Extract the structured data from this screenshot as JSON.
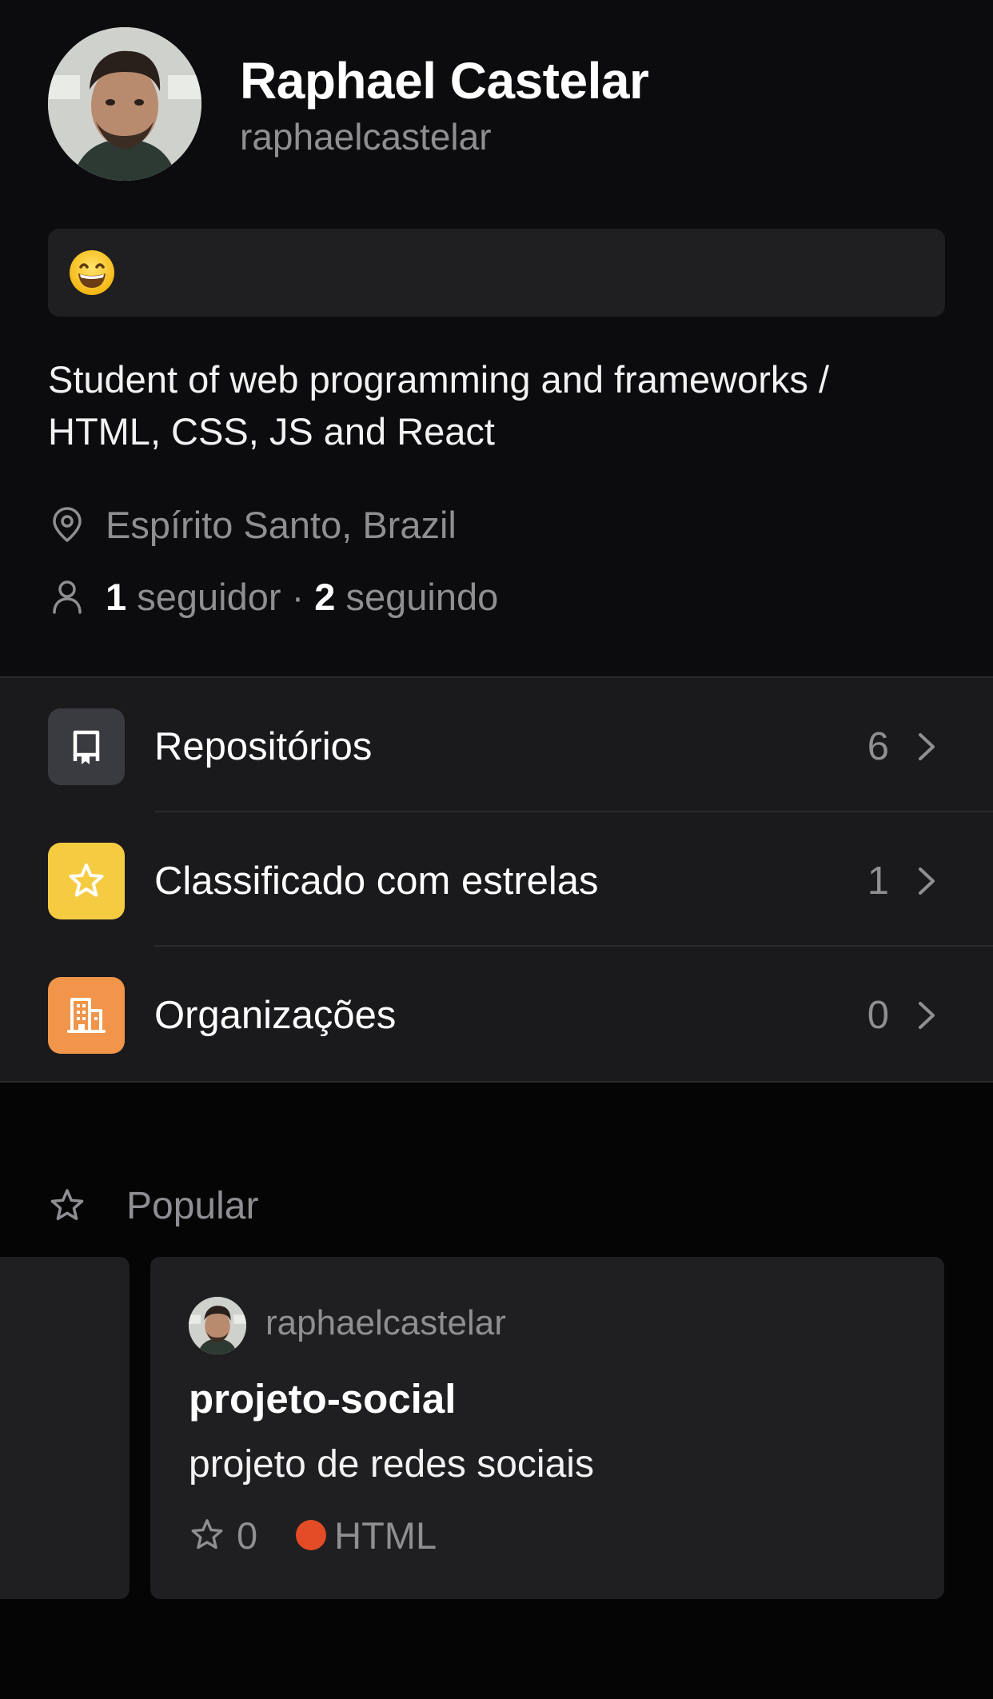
{
  "profile": {
    "name": "Raphael Castelar",
    "login": "raphaelcastelar",
    "status_emoji": "grinning-face",
    "bio": "Student of web programming and frameworks / HTML, CSS, JS and React",
    "location": "Espírito Santo, Brazil",
    "followers_count": "1",
    "followers_label": "seguidor",
    "separator": "·",
    "following_count": "2",
    "following_label": "seguindo"
  },
  "menu": {
    "items": [
      {
        "label": "Repositórios",
        "count": "6",
        "icon": "repo-icon",
        "color": "#3a3b40"
      },
      {
        "label": "Classificado com estrelas",
        "count": "1",
        "icon": "star-icon",
        "color": "#f5cb42"
      },
      {
        "label": "Organizações",
        "count": "0",
        "icon": "organization-icon",
        "color": "#f0954a"
      }
    ]
  },
  "popular": {
    "title": "Popular",
    "icon": "star-icon",
    "card": {
      "owner": "raphaelcastelar",
      "repo_name": "projeto-social",
      "description": "projeto de redes sociais",
      "stars": "0",
      "language": "HTML",
      "language_color": "#e34c26"
    }
  }
}
